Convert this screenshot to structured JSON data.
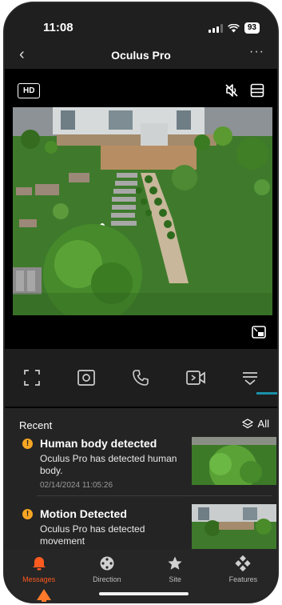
{
  "status_bar": {
    "time": "11:08",
    "battery": "93"
  },
  "header": {
    "title": "Oculus Pro"
  },
  "video": {
    "quality_label": "HD",
    "icons": [
      "mute-icon",
      "layout-icon",
      "picture-in-picture-icon"
    ]
  },
  "controls": [
    "fullscreen-icon",
    "snapshot-icon",
    "call-icon",
    "record-icon",
    "more-controls-icon"
  ],
  "events": {
    "section_label": "Recent",
    "filter_label": "All",
    "items": [
      {
        "title": "Human body detected",
        "description": "Oculus Pro has detected human body.",
        "timestamp": "02/14/2024 11:05:26"
      },
      {
        "title": "Motion Detected",
        "description": "Oculus Pro has detected movement",
        "timestamp": ""
      }
    ]
  },
  "tabs": [
    {
      "label": "Messages",
      "icon": "bell-icon",
      "active": true
    },
    {
      "label": "Direction",
      "icon": "joystick-icon",
      "active": false
    },
    {
      "label": "Site",
      "icon": "star-icon",
      "active": false
    },
    {
      "label": "Features",
      "icon": "grid-icon",
      "active": false
    }
  ],
  "colors": {
    "accent": "#ff5a1f",
    "alert": "#f5a623",
    "teal": "#1a8fa8"
  }
}
